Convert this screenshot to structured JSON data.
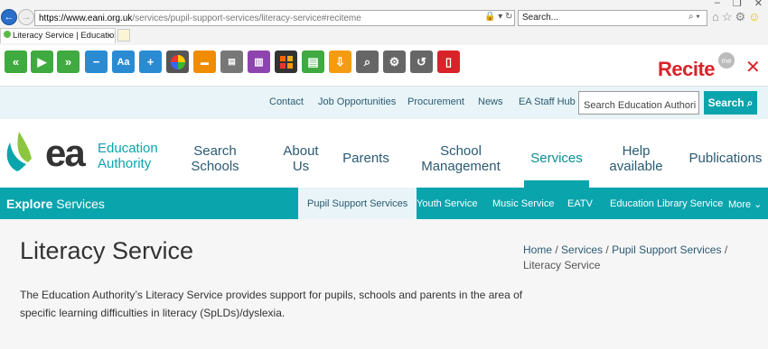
{
  "browser": {
    "address": {
      "host": "https://www.eani.org.uk",
      "path": "/services/pupil-support-services/literacy-service#reciteme"
    },
    "search_placeholder": "Search...",
    "tab_title": "Literacy Service | Education A..."
  },
  "recite": {
    "logo": "Recite",
    "badge": "me",
    "buttons": [
      "rewind-icon",
      "play-icon",
      "fast-forward-icon",
      "minus-icon",
      "font-icon",
      "plus-icon",
      "color-wheel-icon",
      "ruler-icon",
      "screen-mask-icon",
      "dictionary-icon",
      "translate-icon",
      "document-icon",
      "download-icon",
      "search-icon",
      "settings-icon",
      "reset-icon",
      "pdf-icon"
    ]
  },
  "utility": {
    "links": [
      "Contact",
      "Job Opportunities",
      "Procurement",
      "News",
      "EA Staff Hub"
    ],
    "search_value": "Search Education Authori",
    "search_button": "Search"
  },
  "brand": {
    "ea": "ea",
    "line1": "Education",
    "line2": "Authority"
  },
  "nav": {
    "items": [
      {
        "line1": "Search",
        "line2": "Schools"
      },
      {
        "line1": "About",
        "line2": "Us"
      },
      {
        "line1": "Parents",
        "line2": ""
      },
      {
        "line1": "School",
        "line2": "Management"
      },
      {
        "line1": "Services",
        "line2": ""
      },
      {
        "line1": "Help",
        "line2": "available"
      },
      {
        "line1": "Publications",
        "line2": ""
      }
    ]
  },
  "explore": {
    "bold": "Explore",
    "rest": " Services",
    "links": [
      "Pupil Support Services",
      "Youth Service",
      "Music Service",
      "EATV",
      "Education Library Service",
      "More"
    ]
  },
  "page": {
    "title": "Literacy Service",
    "breadcrumb": [
      "Home",
      "Services",
      "Pupil Support Services",
      "Literacy Service"
    ],
    "intro": "The Education Authority’s Literacy Service provides support for pupils, schools and parents in the area of specific learning difficulties in literacy (SpLDs)/dyslexia."
  }
}
